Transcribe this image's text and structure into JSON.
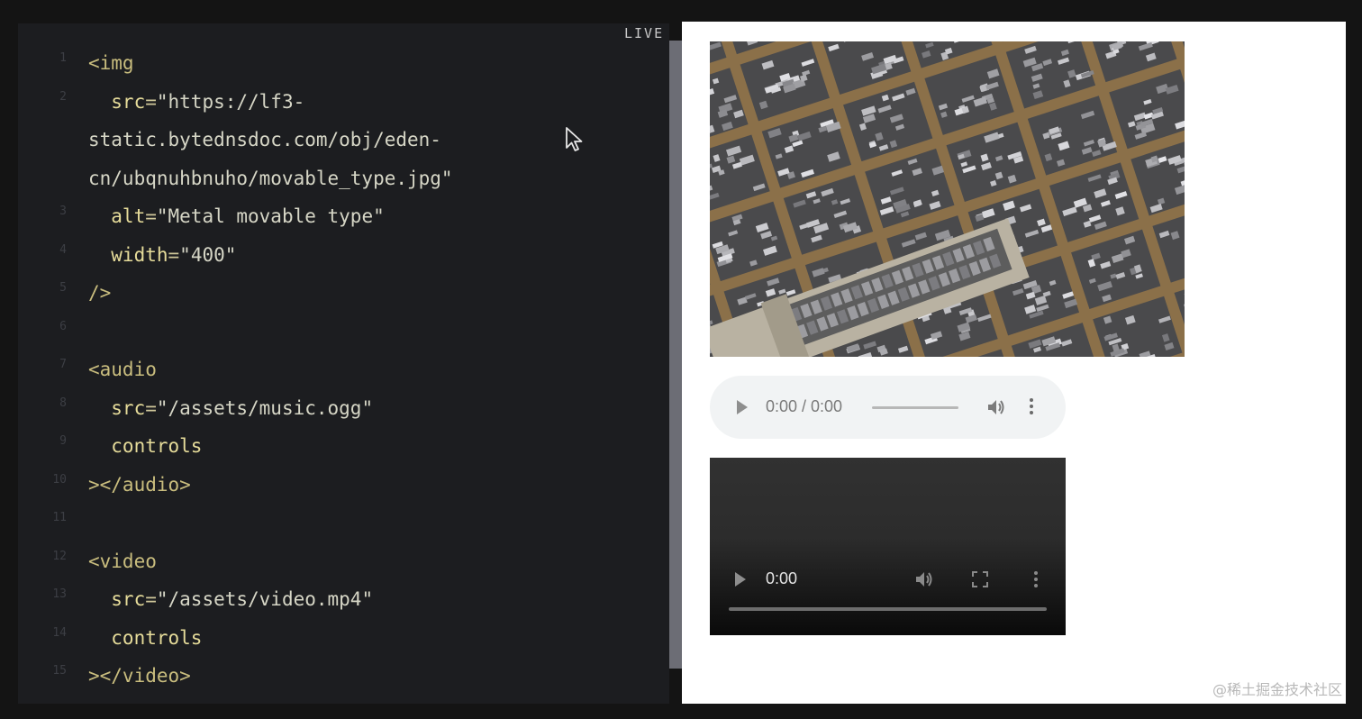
{
  "editor": {
    "live_label": "LIVE",
    "lines": [
      {
        "no": "1",
        "segments": [
          {
            "cls": "tag",
            "text": "<img"
          }
        ]
      },
      {
        "no": "2",
        "segments": [
          {
            "cls": "attr",
            "text": "  src"
          },
          {
            "cls": "punct",
            "text": "="
          },
          {
            "cls": "str",
            "text": "\"https://lf3-"
          }
        ]
      },
      {
        "no": "",
        "segments": [
          {
            "cls": "str",
            "text": "static.bytednsdoc.com/obj/eden-"
          }
        ]
      },
      {
        "no": "",
        "segments": [
          {
            "cls": "str",
            "text": "cn/ubqnuhbnuho/movable_type.jpg\""
          }
        ]
      },
      {
        "no": "3",
        "segments": [
          {
            "cls": "attr",
            "text": "  alt"
          },
          {
            "cls": "punct",
            "text": "="
          },
          {
            "cls": "str",
            "text": "\"Metal movable type\""
          }
        ]
      },
      {
        "no": "4",
        "segments": [
          {
            "cls": "attr",
            "text": "  width"
          },
          {
            "cls": "punct",
            "text": "="
          },
          {
            "cls": "str",
            "text": "\"400\""
          }
        ]
      },
      {
        "no": "5",
        "segments": [
          {
            "cls": "tag",
            "text": "/>"
          }
        ]
      },
      {
        "no": "6",
        "segments": []
      },
      {
        "no": "7",
        "segments": [
          {
            "cls": "tag",
            "text": "<audio"
          }
        ]
      },
      {
        "no": "8",
        "segments": [
          {
            "cls": "attr",
            "text": "  src"
          },
          {
            "cls": "punct",
            "text": "="
          },
          {
            "cls": "str",
            "text": "\"/assets/music.ogg\""
          }
        ]
      },
      {
        "no": "9",
        "segments": [
          {
            "cls": "attr",
            "text": "  controls"
          }
        ]
      },
      {
        "no": "10",
        "segments": [
          {
            "cls": "tag",
            "text": "></audio>"
          }
        ]
      },
      {
        "no": "11",
        "segments": []
      },
      {
        "no": "12",
        "segments": [
          {
            "cls": "tag",
            "text": "<video"
          }
        ]
      },
      {
        "no": "13",
        "segments": [
          {
            "cls": "attr",
            "text": "  src"
          },
          {
            "cls": "punct",
            "text": "="
          },
          {
            "cls": "str",
            "text": "\"/assets/video.mp4\""
          }
        ]
      },
      {
        "no": "14",
        "segments": [
          {
            "cls": "attr",
            "text": "  controls"
          }
        ]
      },
      {
        "no": "15",
        "segments": [
          {
            "cls": "tag",
            "text": "></video>"
          }
        ]
      }
    ]
  },
  "preview": {
    "audio": {
      "time": "0:00 / 0:00"
    },
    "video": {
      "time": "0:00"
    },
    "icons": {
      "play": "play-icon",
      "volume": "volume-icon",
      "fullscreen": "fullscreen-icon",
      "more": "more-vertical-icon"
    }
  },
  "watermark": "@稀土掘金技术社区",
  "colors": {
    "editor_bg": "#1c1d20",
    "tag": "#c9bd7e",
    "attr": "#e6dc9a",
    "preview_bg": "#ffffff",
    "audio_bg": "#f1f3f4"
  }
}
